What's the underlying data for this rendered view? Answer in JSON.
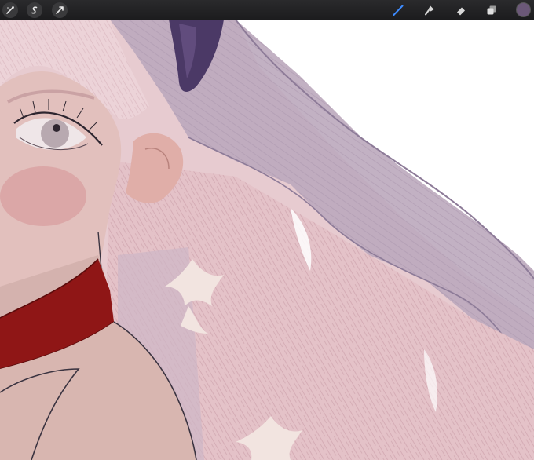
{
  "toolbar": {
    "left_tools": [
      {
        "name": "adjustments-icon"
      },
      {
        "name": "selection-icon"
      },
      {
        "name": "transform-icon"
      }
    ],
    "right_tools": [
      {
        "name": "brush-icon",
        "active": true
      },
      {
        "name": "smudge-icon"
      },
      {
        "name": "eraser-icon"
      },
      {
        "name": "layers-icon"
      }
    ],
    "current_color": "#6b5878",
    "active_color": "#3d8bff"
  },
  "palette": {
    "hair": "#e6c8ce",
    "hair_shadow": "#cdaeb8",
    "veil": "#b7a3b9",
    "veil_dark": "#9d8aa4",
    "skin": "#d8b3b1",
    "blush": "#d79a9b",
    "collar": "#8f1616",
    "hair_ribbon": "#4b3966",
    "outline": "#3a3340",
    "flower": "#f2e4e0"
  }
}
